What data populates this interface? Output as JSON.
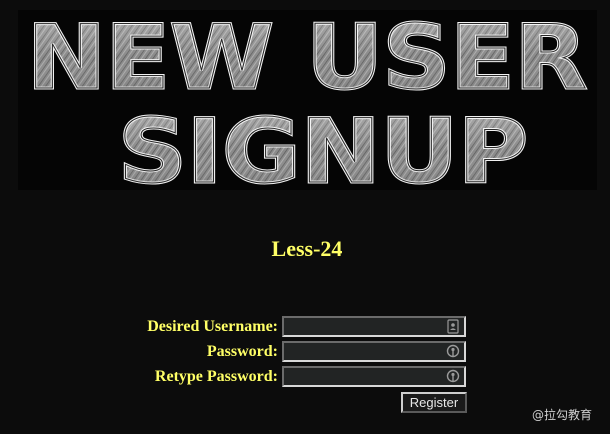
{
  "banner": {
    "line1": "NEW USER",
    "line2": "SIGNUP"
  },
  "level_title": "Less-24",
  "form": {
    "username_label": "Desired Username:",
    "password_label": "Password:",
    "retype_label": "Retype Password:",
    "username_value": "",
    "password_value": "",
    "retype_value": "",
    "register_label": "Register"
  },
  "watermark": "@拉勾教育",
  "icons": {
    "username": "contact-card-icon",
    "password": "key-icon",
    "retype": "key-icon"
  },
  "colors": {
    "background": "#0c0c0c",
    "label": "#ffff66"
  }
}
